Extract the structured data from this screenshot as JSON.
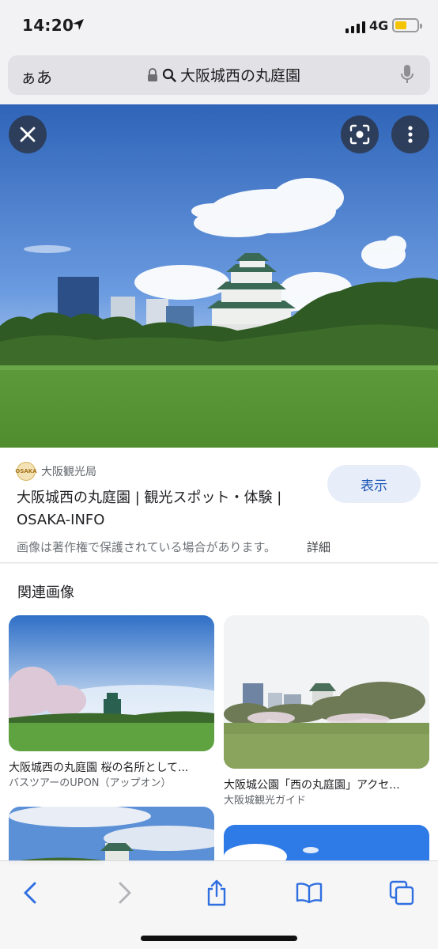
{
  "status": {
    "time": "14:20",
    "network": "4G",
    "battery_fraction": 0.55
  },
  "address": {
    "aa_label": "ぁあ",
    "query": "大阪城西の丸庭園"
  },
  "hero": {
    "close_icon": "close-icon",
    "lens_icon": "lens-icon",
    "more_icon": "more-vertical-icon"
  },
  "source": {
    "logo_text": "OSAKA",
    "site_name": "大阪観光局",
    "title_line1": "大阪城西の丸庭園 | 観光スポット・体験 |",
    "title_line2": "OSAKA-INFO",
    "visit_label": "表示",
    "copyright_note": "画像は著作権で保護されている場合があります。",
    "details_label": "詳細"
  },
  "related": {
    "heading": "関連画像",
    "items": [
      {
        "title": "大阪城西の丸庭園 桜の名所として...",
        "source": "バスツアーのUPON（アップオン）"
      },
      {
        "title": "大阪城公園「西の丸庭園」アクセ...",
        "source": "大阪城観光ガイド"
      },
      {
        "title": "",
        "source": ""
      },
      {
        "title": "",
        "source": ""
      }
    ]
  },
  "toolbar": {
    "back_icon": "back-chevron-icon",
    "forward_icon": "forward-chevron-icon",
    "share_icon": "share-icon",
    "bookmarks_icon": "bookmarks-icon",
    "tabs_icon": "tabs-icon"
  }
}
